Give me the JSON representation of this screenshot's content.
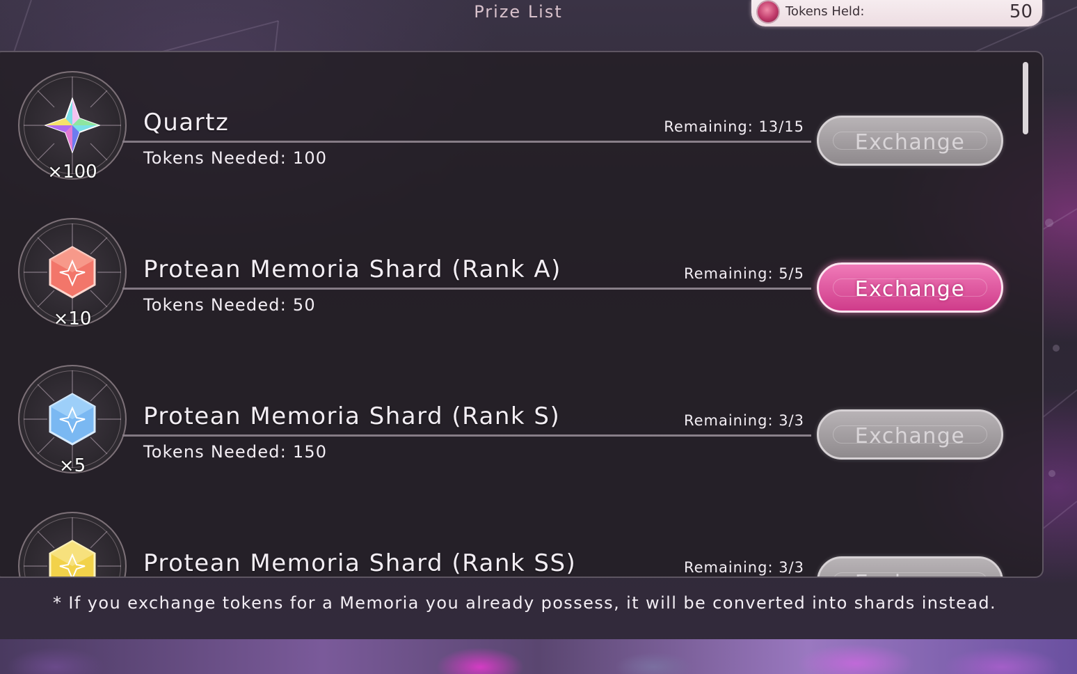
{
  "header": {
    "title": "Prize List",
    "tokens_label": "Tokens Held:",
    "tokens_value": "50"
  },
  "prizes": [
    {
      "name": "Quartz",
      "quantity": "×100",
      "tokens_needed": "Tokens Needed: 100",
      "remaining": "Remaining: 13/15",
      "button": "Exchange",
      "button_state": "disabled",
      "icon": "rainbow-star-crystal-icon"
    },
    {
      "name": "Protean Memoria Shard (Rank A)",
      "quantity": "×10",
      "tokens_needed": "Tokens Needed: 50",
      "remaining": "Remaining: 5/5",
      "button": "Exchange",
      "button_state": "active",
      "icon": "red-hexagon-shard-icon"
    },
    {
      "name": "Protean Memoria Shard (Rank S)",
      "quantity": "×5",
      "tokens_needed": "Tokens Needed: 150",
      "remaining": "Remaining: 3/3",
      "button": "Exchange",
      "button_state": "disabled",
      "icon": "blue-hexagon-shard-icon"
    },
    {
      "name": "Protean Memoria Shard (Rank SS)",
      "quantity": "",
      "tokens_needed": "",
      "remaining": "Remaining: 3/3",
      "button": "Exchange",
      "button_state": "disabled",
      "icon": "gold-hexagon-shard-icon"
    }
  ],
  "footnote": "* If you exchange tokens for a Memoria you already possess, it will be converted into shards instead.",
  "colors": {
    "active_button": "#e0589f",
    "disabled_button": "#a39fa2",
    "panel": "#231f25",
    "text": "#f3eef4"
  }
}
